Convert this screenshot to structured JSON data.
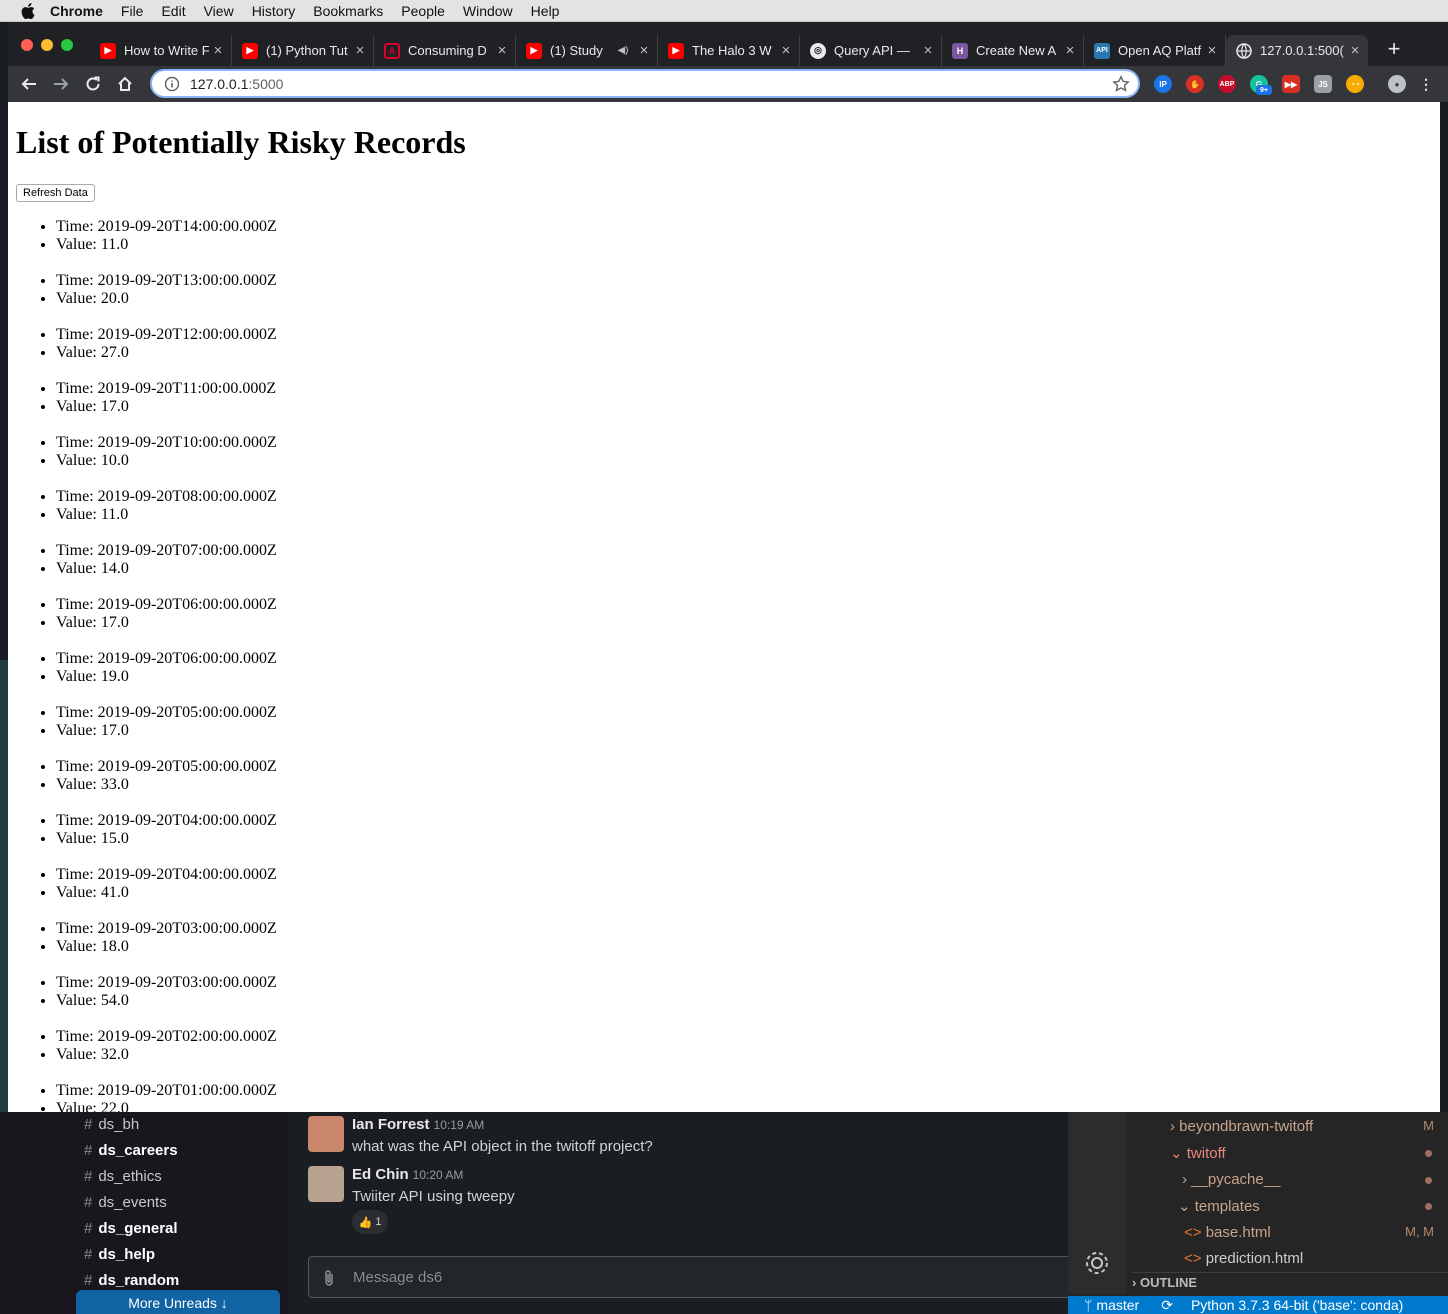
{
  "menubar": {
    "app_name": "Chrome",
    "items": [
      "File",
      "Edit",
      "View",
      "History",
      "Bookmarks",
      "People",
      "Window",
      "Help"
    ]
  },
  "tabs": [
    {
      "title": "How to Write F",
      "favicon": "youtube-icon"
    },
    {
      "title": "(1) Python Tut",
      "favicon": "youtube-icon"
    },
    {
      "title": "Consuming D",
      "favicon": "angular-icon"
    },
    {
      "title": "(1) Study",
      "favicon": "youtube-icon"
    },
    {
      "title": "The Halo 3 W",
      "favicon": "youtube-icon"
    },
    {
      "title": "Query API —",
      "favicon": "openaq-icon"
    },
    {
      "title": "Create New A",
      "favicon": "heroku-icon"
    },
    {
      "title": "Open AQ Platf",
      "favicon": "api-icon"
    },
    {
      "title": "127.0.0.1:500(",
      "favicon": "globe-icon",
      "active": true
    }
  ],
  "address_bar": {
    "host": "127.0.0.1",
    "port": ":5000"
  },
  "extensions": [
    "ip-icon",
    "stop-icon",
    "abp-icon",
    "grammarly-icon",
    "youtube-ext-icon",
    "js-icon",
    "cookie-icon",
    "profile-avatar"
  ],
  "extension_badge": "9+",
  "page": {
    "heading": "List of Potentially Risky Records",
    "refresh_label": "Refresh Data",
    "records": [
      {
        "time": "Time: 2019-09-20T14:00:00.000Z",
        "value": "Value: 11.0"
      },
      {
        "time": "Time: 2019-09-20T13:00:00.000Z",
        "value": "Value: 20.0"
      },
      {
        "time": "Time: 2019-09-20T12:00:00.000Z",
        "value": "Value: 27.0"
      },
      {
        "time": "Time: 2019-09-20T11:00:00.000Z",
        "value": "Value: 17.0"
      },
      {
        "time": "Time: 2019-09-20T10:00:00.000Z",
        "value": "Value: 10.0"
      },
      {
        "time": "Time: 2019-09-20T08:00:00.000Z",
        "value": "Value: 11.0"
      },
      {
        "time": "Time: 2019-09-20T07:00:00.000Z",
        "value": "Value: 14.0"
      },
      {
        "time": "Time: 2019-09-20T06:00:00.000Z",
        "value": "Value: 17.0"
      },
      {
        "time": "Time: 2019-09-20T06:00:00.000Z",
        "value": "Value: 19.0"
      },
      {
        "time": "Time: 2019-09-20T05:00:00.000Z",
        "value": "Value: 17.0"
      },
      {
        "time": "Time: 2019-09-20T05:00:00.000Z",
        "value": "Value: 33.0"
      },
      {
        "time": "Time: 2019-09-20T04:00:00.000Z",
        "value": "Value: 15.0"
      },
      {
        "time": "Time: 2019-09-20T04:00:00.000Z",
        "value": "Value: 41.0"
      },
      {
        "time": "Time: 2019-09-20T03:00:00.000Z",
        "value": "Value: 18.0"
      },
      {
        "time": "Time: 2019-09-20T03:00:00.000Z",
        "value": "Value: 54.0"
      },
      {
        "time": "Time: 2019-09-20T02:00:00.000Z",
        "value": "Value: 32.0"
      },
      {
        "time": "Time: 2019-09-20T01:00:00.000Z",
        "value": "Value: 22.0"
      }
    ]
  },
  "slack": {
    "channels": [
      {
        "name": "ds_bh",
        "bold": false
      },
      {
        "name": "ds_careers",
        "bold": true
      },
      {
        "name": "ds_ethics",
        "bold": false
      },
      {
        "name": "ds_events",
        "bold": false
      },
      {
        "name": "ds_general",
        "bold": true
      },
      {
        "name": "ds_help",
        "bold": true
      },
      {
        "name": "ds_random",
        "bold": true
      }
    ],
    "more_unreads": "More Unreads",
    "messages": [
      {
        "author": "Ian Forrest",
        "time": "10:19 AM",
        "text": "what was the API object in the twitoff project?"
      },
      {
        "author": "Ed Chin",
        "time": "10:20 AM",
        "text": "Twiiter API  using tweepy"
      }
    ],
    "reaction_count": "1",
    "input_placeholder": "Message ds6"
  },
  "vscode": {
    "tree": [
      "beyondbrawn-twitoff",
      "twitoff",
      "__pycache__",
      "templates",
      "base.html",
      "prediction.html"
    ],
    "badges": [
      "M",
      "M, M"
    ],
    "outline_label": "OUTLINE",
    "branch": "master",
    "interpreter": "Python 3.7.3 64-bit ('base': conda)"
  },
  "colors": {
    "tab_bg": "#202124",
    "active_tab": "#35363a",
    "accent": "#8ab4f8",
    "youtube_red": "#ff0000",
    "vscode_blue": "#007acc",
    "slack_blue": "#1164a3"
  }
}
